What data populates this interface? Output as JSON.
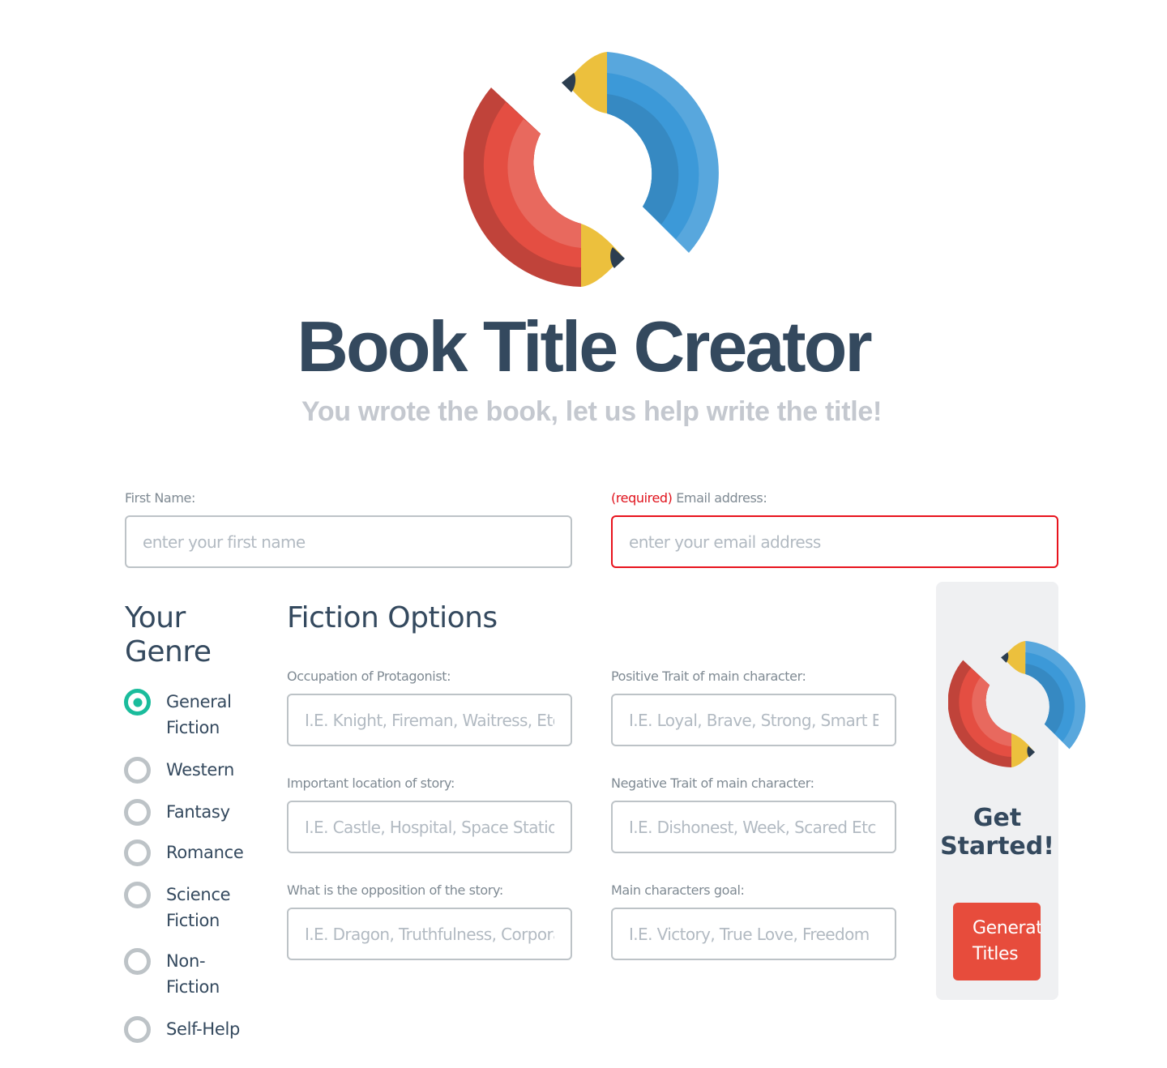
{
  "header": {
    "title": "Book Title Creator",
    "subtitle": "You wrote the book, let us help write the title!",
    "logo_icon": "pencils-circle-logo"
  },
  "colors": {
    "primary_text": "#34495e",
    "accent_green": "#1abc9c",
    "accent_red": "#e74c3c",
    "error_red": "#e8131d",
    "input_border": "#bdc3c7",
    "panel_bg": "#eff0f2"
  },
  "contact": {
    "first_name": {
      "label": "First Name:",
      "value": "",
      "placeholder": "enter your first name"
    },
    "email": {
      "required_tag": "(required)",
      "label": " Email address:",
      "value": "",
      "placeholder": "enter your email address"
    }
  },
  "genre": {
    "heading": "Your Genre",
    "selected": "General Fiction",
    "options": [
      {
        "label": "General Fiction",
        "checked": true
      },
      {
        "label": "Western",
        "checked": false
      },
      {
        "label": "Fantasy",
        "checked": false
      },
      {
        "label": "Romance",
        "checked": false
      },
      {
        "label": "Science Fiction",
        "checked": false
      },
      {
        "label": "Non-Fiction",
        "checked": false
      },
      {
        "label": "Self-Help",
        "checked": false
      }
    ]
  },
  "fiction_options": {
    "heading": "Fiction Options",
    "fields": [
      {
        "label": "Occupation of Protagonist:",
        "placeholder": "I.E. Knight, Fireman, Waitress, Etc",
        "value": ""
      },
      {
        "label": "Positive Trait of main character:",
        "placeholder": "I.E. Loyal, Brave, Strong, Smart Etc",
        "value": ""
      },
      {
        "label": "Important location of story:",
        "placeholder": "I.E. Castle, Hospital, Space Station",
        "value": ""
      },
      {
        "label": "Negative Trait of main character:",
        "placeholder": "I.E. Dishonest, Week, Scared Etc",
        "value": ""
      },
      {
        "label": "What is the opposition of the story:",
        "placeholder": "I.E. Dragon, Truthfulness, Corporation",
        "value": ""
      },
      {
        "label": "Main characters goal:",
        "placeholder": "I.E. Victory, True Love, Freedom",
        "value": ""
      }
    ]
  },
  "side_panel": {
    "logo_icon": "pencils-circle-logo",
    "heading": "Get Started!",
    "button_label": "Generate Titles"
  }
}
